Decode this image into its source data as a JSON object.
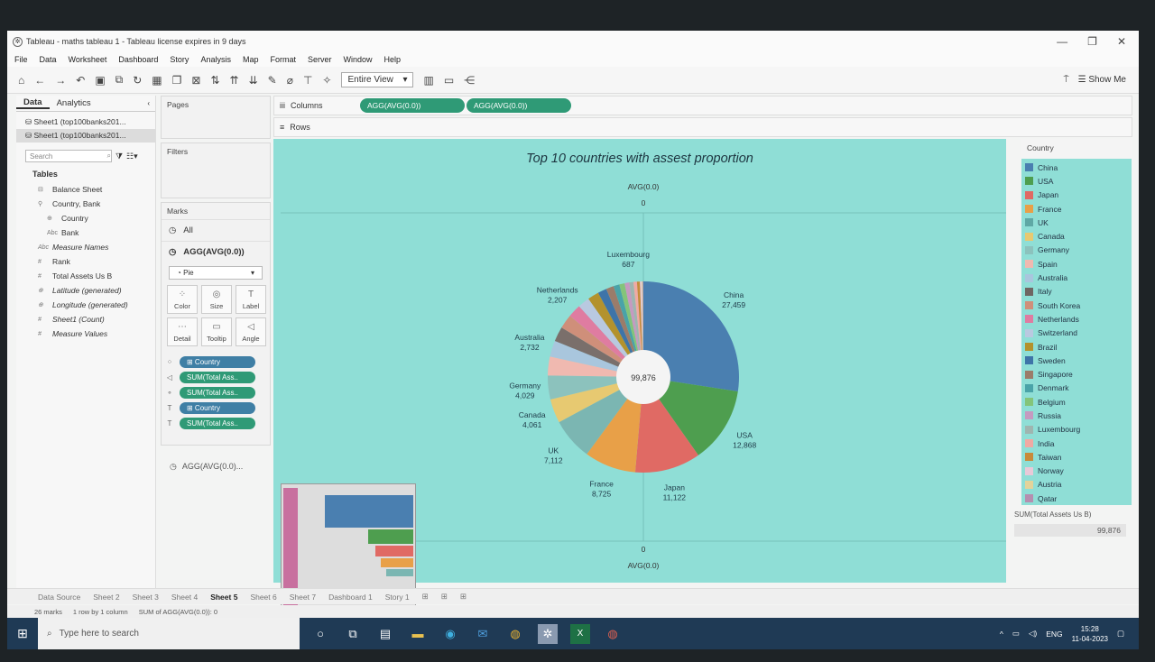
{
  "window": {
    "title": "Tableau - maths tableau 1 - Tableau license expires in 9 days",
    "controls": [
      "—",
      "❐",
      "✕"
    ]
  },
  "menu": [
    "File",
    "Data",
    "Worksheet",
    "Dashboard",
    "Story",
    "Analysis",
    "Map",
    "Format",
    "Server",
    "Window",
    "Help"
  ],
  "toolbar": {
    "view_mode": "Entire View",
    "show_me": "Show Me"
  },
  "data_pane": {
    "tabs": [
      "Data",
      "Analytics"
    ],
    "sources": [
      "Sheet1 (top100banks201...",
      "Sheet1 (top100banks201..."
    ],
    "search_placeholder": "Search",
    "tables_heading": "Tables",
    "fields": [
      {
        "icon": "⊟",
        "name": "Balance Sheet",
        "italic": false,
        "indent": false
      },
      {
        "icon": "⚲",
        "name": "Country, Bank",
        "italic": false,
        "indent": false
      },
      {
        "icon": "⊕",
        "name": "Country",
        "italic": false,
        "indent": true
      },
      {
        "icon": "Abc",
        "name": "Bank",
        "italic": false,
        "indent": true
      },
      {
        "icon": "Abc",
        "name": "Measure Names",
        "italic": true,
        "indent": false
      },
      {
        "icon": "#",
        "name": "Rank",
        "italic": false,
        "indent": false
      },
      {
        "icon": "#",
        "name": "Total Assets Us B",
        "italic": false,
        "indent": false
      },
      {
        "icon": "⊕",
        "name": "Latitude (generated)",
        "italic": true,
        "indent": false
      },
      {
        "icon": "⊕",
        "name": "Longitude (generated)",
        "italic": true,
        "indent": false
      },
      {
        "icon": "#",
        "name": "Sheet1 (Count)",
        "italic": true,
        "indent": false
      },
      {
        "icon": "#",
        "name": "Measure Values",
        "italic": true,
        "indent": false
      }
    ]
  },
  "cards": {
    "pages": "Pages",
    "filters": "Filters",
    "marks": "Marks",
    "all": "All",
    "agg": "AGG(AVG(0.0))",
    "mark_type": "Pie",
    "buttons": [
      "Color",
      "Size",
      "Label",
      "Detail",
      "Tooltip",
      "Angle"
    ],
    "pills": [
      {
        "icon": "⁘",
        "label": "⊞ Country",
        "color": "blue"
      },
      {
        "icon": "◁",
        "label": "SUM(Total Ass..",
        "color": "green"
      },
      {
        "icon": "⚬",
        "label": "SUM(Total Ass..",
        "color": "green"
      },
      {
        "icon": "T",
        "label": "⊞ Country",
        "color": "blue"
      },
      {
        "icon": "T",
        "label": "SUM(Total Ass..",
        "color": "green"
      }
    ],
    "agg_bottom": "AGG(AVG(0.0)..."
  },
  "shelves": {
    "columns_label": "Columns",
    "columns_pills": [
      "AGG(AVG(0.0))",
      "AGG(AVG(0.0))"
    ],
    "rows_label": "Rows"
  },
  "viz": {
    "title": "Top 10 countries with assest proportion",
    "axis_top": "AVG(0.0)",
    "axis_top_val": "0",
    "axis_bottom_val": "0",
    "axis_bottom": "AVG(0.0)",
    "center_total": "99,876"
  },
  "chart_data": {
    "type": "pie",
    "title": "Top 10 countries with assest proportion",
    "total": 99876,
    "slices": [
      {
        "name": "China",
        "value": 27459,
        "color": "#4a7fb0",
        "label": true
      },
      {
        "name": "USA",
        "value": 12868,
        "color": "#4e9e4f",
        "label": true
      },
      {
        "name": "Japan",
        "value": 11122,
        "color": "#e06a64",
        "label": true
      },
      {
        "name": "France",
        "value": 8725,
        "color": "#e8a048",
        "label": true
      },
      {
        "name": "UK",
        "value": 7112,
        "color": "#7bb6b2",
        "label": true
      },
      {
        "name": "Canada",
        "value": 4061,
        "color": "#e7c971",
        "label": true
      },
      {
        "name": "Germany",
        "value": 4029,
        "color": "#8cc2bd",
        "label": true
      },
      {
        "name": "Spain",
        "value": 3200,
        "color": "#f0b9b0",
        "label": false
      },
      {
        "name": "Australia",
        "value": 2732,
        "color": "#a9c6dd",
        "label": true
      },
      {
        "name": "Italy",
        "value": 2500,
        "color": "#7a6f6b",
        "label": false
      },
      {
        "name": "South Korea",
        "value": 2400,
        "color": "#cf8f7a",
        "label": false
      },
      {
        "name": "Netherlands",
        "value": 2207,
        "color": "#df7ca1",
        "label": true
      },
      {
        "name": "Switzerland",
        "value": 2000,
        "color": "#b9c9e0",
        "label": false
      },
      {
        "name": "Brazil",
        "value": 1900,
        "color": "#b3922d",
        "label": false
      },
      {
        "name": "Sweden",
        "value": 1500,
        "color": "#3e74a8",
        "label": false
      },
      {
        "name": "Singapore",
        "value": 1300,
        "color": "#9b7c6a",
        "label": false
      },
      {
        "name": "Denmark",
        "value": 1000,
        "color": "#4aa3a8",
        "label": false
      },
      {
        "name": "Belgium",
        "value": 900,
        "color": "#84c47a",
        "label": false
      },
      {
        "name": "Russia",
        "value": 800,
        "color": "#c59ac0",
        "label": false
      },
      {
        "name": "Luxembourg",
        "value": 687,
        "color": "#9fb5b0",
        "label": true
      },
      {
        "name": "India",
        "value": 600,
        "color": "#f0a9a3",
        "label": false
      },
      {
        "name": "Taiwan",
        "value": 500,
        "color": "#c88a3a",
        "label": false
      },
      {
        "name": "Norway",
        "value": 300,
        "color": "#e8c9d8",
        "label": false
      },
      {
        "name": "Austria",
        "value": 150,
        "color": "#e3d39a",
        "label": false
      },
      {
        "name": "Qatar",
        "value": 120,
        "color": "#b58fb0",
        "label": false
      }
    ]
  },
  "legend": {
    "title": "Country",
    "items": [
      {
        "name": "China",
        "color": "#4a7fb0"
      },
      {
        "name": "USA",
        "color": "#4e9e4f"
      },
      {
        "name": "Japan",
        "color": "#e06a64"
      },
      {
        "name": "France",
        "color": "#e8a048"
      },
      {
        "name": "UK",
        "color": "#5fa8a5"
      },
      {
        "name": "Canada",
        "color": "#e7c971"
      },
      {
        "name": "Germany",
        "color": "#8cc2bd"
      },
      {
        "name": "Spain",
        "color": "#f0b9b0"
      },
      {
        "name": "Australia",
        "color": "#a9c6dd"
      },
      {
        "name": "Italy",
        "color": "#6f6663"
      },
      {
        "name": "South Korea",
        "color": "#cf8f7a"
      },
      {
        "name": "Netherlands",
        "color": "#df7ca1"
      },
      {
        "name": "Switzerland",
        "color": "#b9c9e0"
      },
      {
        "name": "Brazil",
        "color": "#b3922d"
      },
      {
        "name": "Sweden",
        "color": "#3e74a8"
      },
      {
        "name": "Singapore",
        "color": "#9b7c6a"
      },
      {
        "name": "Denmark",
        "color": "#4aa3a8"
      },
      {
        "name": "Belgium",
        "color": "#84c47a"
      },
      {
        "name": "Russia",
        "color": "#c59ac0"
      },
      {
        "name": "Luxembourg",
        "color": "#9fb5b0"
      },
      {
        "name": "India",
        "color": "#f0a9a3"
      },
      {
        "name": "Taiwan",
        "color": "#c88a3a"
      },
      {
        "name": "Norway",
        "color": "#e8c9d8"
      },
      {
        "name": "Austria",
        "color": "#e3d39a"
      },
      {
        "name": "Qatar",
        "color": "#b58fb0"
      }
    ],
    "sum_title": "SUM(Total Assets Us B)",
    "sum_value": "99,876"
  },
  "tabs": [
    "Data Source",
    "Sheet 2",
    "Sheet 3",
    "Sheet 4",
    "Sheet 5",
    "Sheet 6",
    "Sheet 7",
    "Dashboard 1",
    "Story 1"
  ],
  "active_tab": "Sheet 5",
  "status": [
    "26 marks",
    "1 row by 1 column",
    "SUM of AGG(AVG(0.0)): 0"
  ],
  "taskbar": {
    "search_placeholder": "Type here to search",
    "lang": "ENG",
    "time": "15:28",
    "date": "11-04-2023"
  }
}
